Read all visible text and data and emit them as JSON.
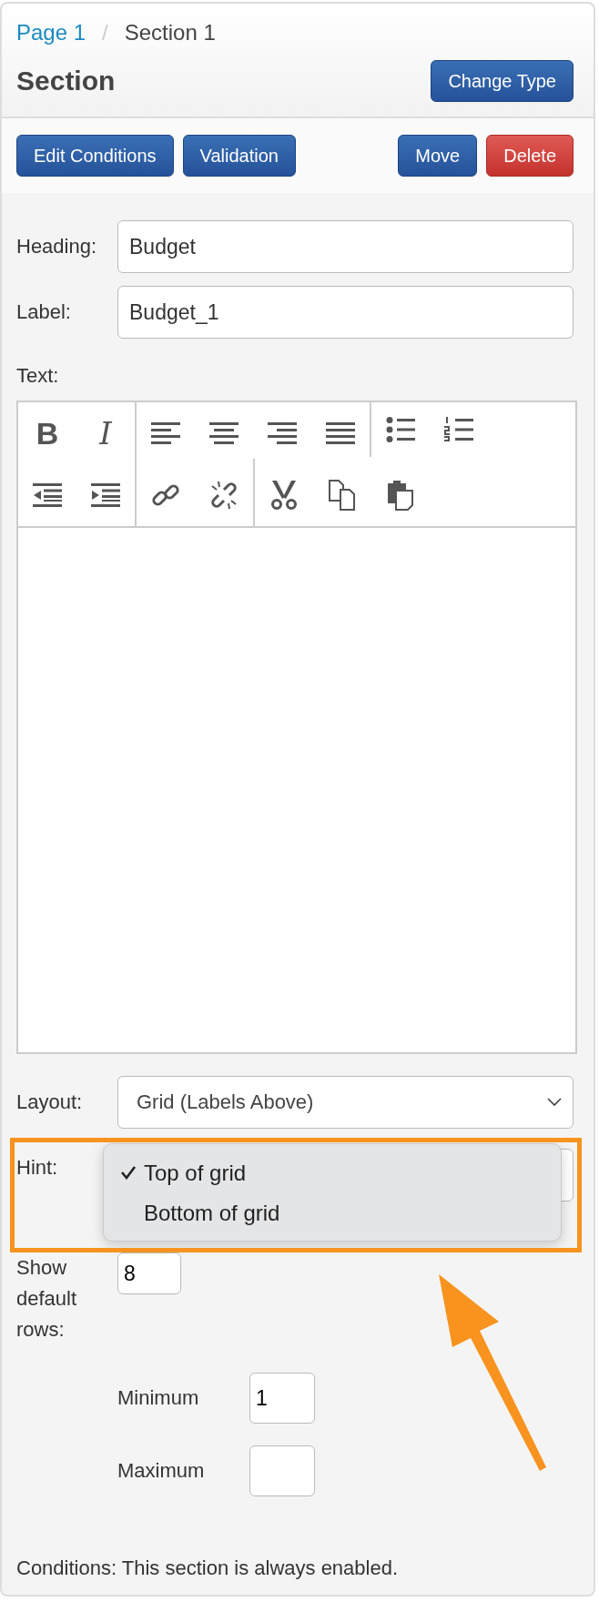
{
  "breadcrumb": [
    {
      "label": "Page 1",
      "link": true
    },
    {
      "label": "Section 1",
      "link": false
    }
  ],
  "breadcrumb_separator": "/",
  "title": "Section",
  "change_type_button": "Change Type",
  "actions": [
    {
      "label": "Edit Conditions",
      "kind": "primary"
    },
    {
      "label": "Validation",
      "kind": "primary"
    },
    {
      "label": "Move",
      "kind": "primary"
    },
    {
      "label": "Delete",
      "kind": "danger"
    }
  ],
  "fields": [
    {
      "label": "Heading:",
      "value": "Budget"
    },
    {
      "label": "Label:",
      "value": "Budget_1"
    }
  ],
  "text_label": "Text:",
  "toolbar": [
    [
      [
        {
          "kind": "bold",
          "glyph": "B"
        },
        {
          "kind": "italic",
          "glyph": "I"
        }
      ],
      [
        {
          "kind": "align-left"
        },
        {
          "kind": "align-center"
        },
        {
          "kind": "align-right"
        },
        {
          "kind": "justify"
        }
      ],
      [
        {
          "kind": "bullet-list"
        },
        {
          "kind": "numbered-list"
        }
      ]
    ],
    [
      [
        {
          "kind": "outdent"
        },
        {
          "kind": "indent"
        }
      ],
      [
        {
          "kind": "link"
        },
        {
          "kind": "unlink"
        }
      ],
      [
        {
          "kind": "cut"
        },
        {
          "kind": "copy"
        },
        {
          "kind": "paste"
        }
      ]
    ]
  ],
  "layout": {
    "label": "Layout:",
    "value": "Grid (Labels Above)"
  },
  "hint": {
    "label": "Hint:",
    "options": [
      {
        "label": "Top of grid",
        "selected": true
      },
      {
        "label": "Bottom of grid",
        "selected": false
      }
    ]
  },
  "default_rows": {
    "label": "Show default rows:",
    "value": "8"
  },
  "limits": [
    {
      "label": "Minimum",
      "value": "1"
    },
    {
      "label": "Maximum"
    }
  ],
  "conditions": "Conditions: This section is always enabled."
}
